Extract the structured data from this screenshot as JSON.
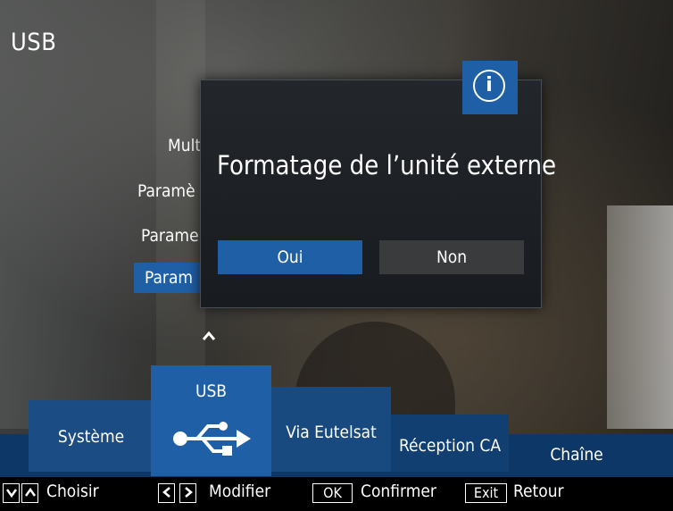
{
  "header": {
    "title": "USB"
  },
  "menu": {
    "items": [
      {
        "label": "Mult"
      },
      {
        "label": "Paramè"
      },
      {
        "label": "Parame"
      },
      {
        "label": "Param"
      }
    ]
  },
  "dialog": {
    "message": "Formatage de l’unité externe",
    "yes_label": "Oui",
    "no_label": "Non",
    "info_glyph": "i"
  },
  "carousel": {
    "tiles": [
      {
        "label": "Système"
      },
      {
        "label": "USB"
      },
      {
        "label": "Via Eutelsat"
      },
      {
        "label": "Réception CA"
      },
      {
        "label": "Chaîne"
      }
    ]
  },
  "help": {
    "choose_label": "Choisir",
    "modify_label": "Modifier",
    "ok_key": "OK",
    "confirm_label": "Confirmer",
    "exit_key": "Exit",
    "back_label": "Retour"
  },
  "colors": {
    "accent_blue": "#1f5fa6",
    "bottom_band": "#0d3766",
    "dialog_bg": "#1b1e22",
    "button_gray": "#3a3b3d"
  }
}
